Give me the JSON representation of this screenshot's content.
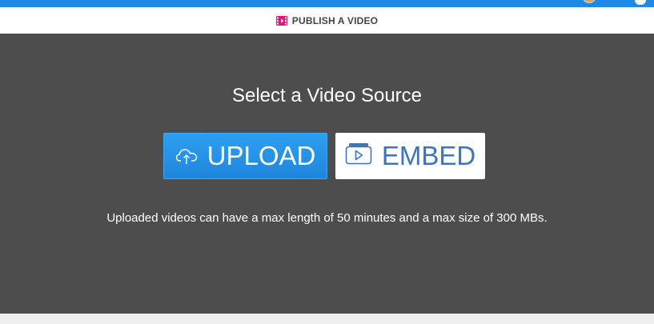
{
  "header": {
    "publish_label": "PUBLISH A VIDEO"
  },
  "main": {
    "title": "Select a Video Source",
    "upload_label": "UPLOAD",
    "embed_label": "EMBED",
    "note": "Uploaded videos can have a max length of 50 minutes and a max size of 300 MBs."
  },
  "icons": {
    "publish": "film-icon",
    "upload": "cloud-upload-icon",
    "embed": "embed-video-icon"
  },
  "colors": {
    "top_bar": "#1e88e5",
    "panel": "#4d4d4d",
    "upload_button": "#1e88e5",
    "embed_text": "#3a74c2",
    "publish_icon": "#d81b7a"
  }
}
